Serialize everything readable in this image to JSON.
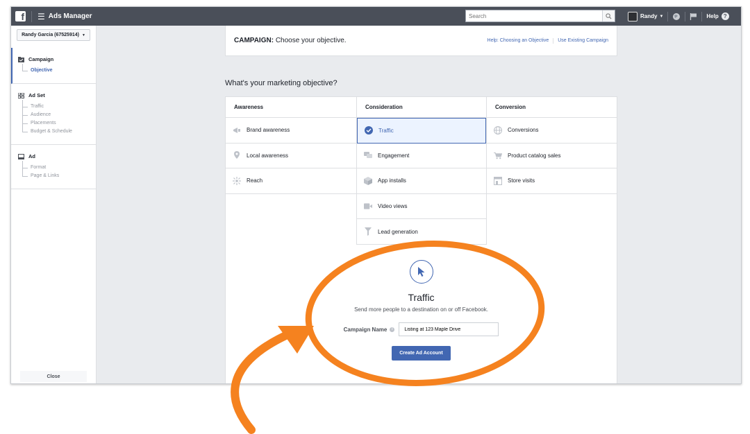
{
  "topbar": {
    "logo": "f",
    "app_title": "Ads Manager",
    "search_placeholder": "Search",
    "user_name": "Randy",
    "help_label": "Help"
  },
  "sidebar": {
    "account": "Randy Garcia (67525914)",
    "campaign": {
      "label": "Campaign",
      "items": [
        "Objective"
      ]
    },
    "adset": {
      "label": "Ad Set",
      "items": [
        "Traffic",
        "Audience",
        "Placements",
        "Budget & Schedule"
      ]
    },
    "ad": {
      "label": "Ad",
      "items": [
        "Format",
        "Page & Links"
      ]
    },
    "close_label": "Close"
  },
  "header": {
    "prefix": "CAMPAIGN:",
    "title": "Choose your objective.",
    "help_link": "Help: Choosing an Objective",
    "existing_link": "Use Existing Campaign"
  },
  "question": "What's your marketing objective?",
  "columns": [
    {
      "title": "Awareness",
      "options": [
        "Brand awareness",
        "Local awareness",
        "Reach"
      ]
    },
    {
      "title": "Consideration",
      "options": [
        "Traffic",
        "Engagement",
        "App installs",
        "Video views",
        "Lead generation"
      ]
    },
    {
      "title": "Conversion",
      "options": [
        "Conversions",
        "Product catalog sales",
        "Store visits"
      ]
    }
  ],
  "selected_option": "Traffic",
  "detail": {
    "title": "Traffic",
    "description": "Send more people to a destination on or off Facebook.",
    "campaign_name_label": "Campaign Name",
    "campaign_name_value": "Listing at 123 Maple Drive",
    "create_button": "Create Ad Account"
  },
  "colors": {
    "accent": "#4267b2",
    "topbar": "#4a4f59",
    "annotation": "#f5821f"
  }
}
